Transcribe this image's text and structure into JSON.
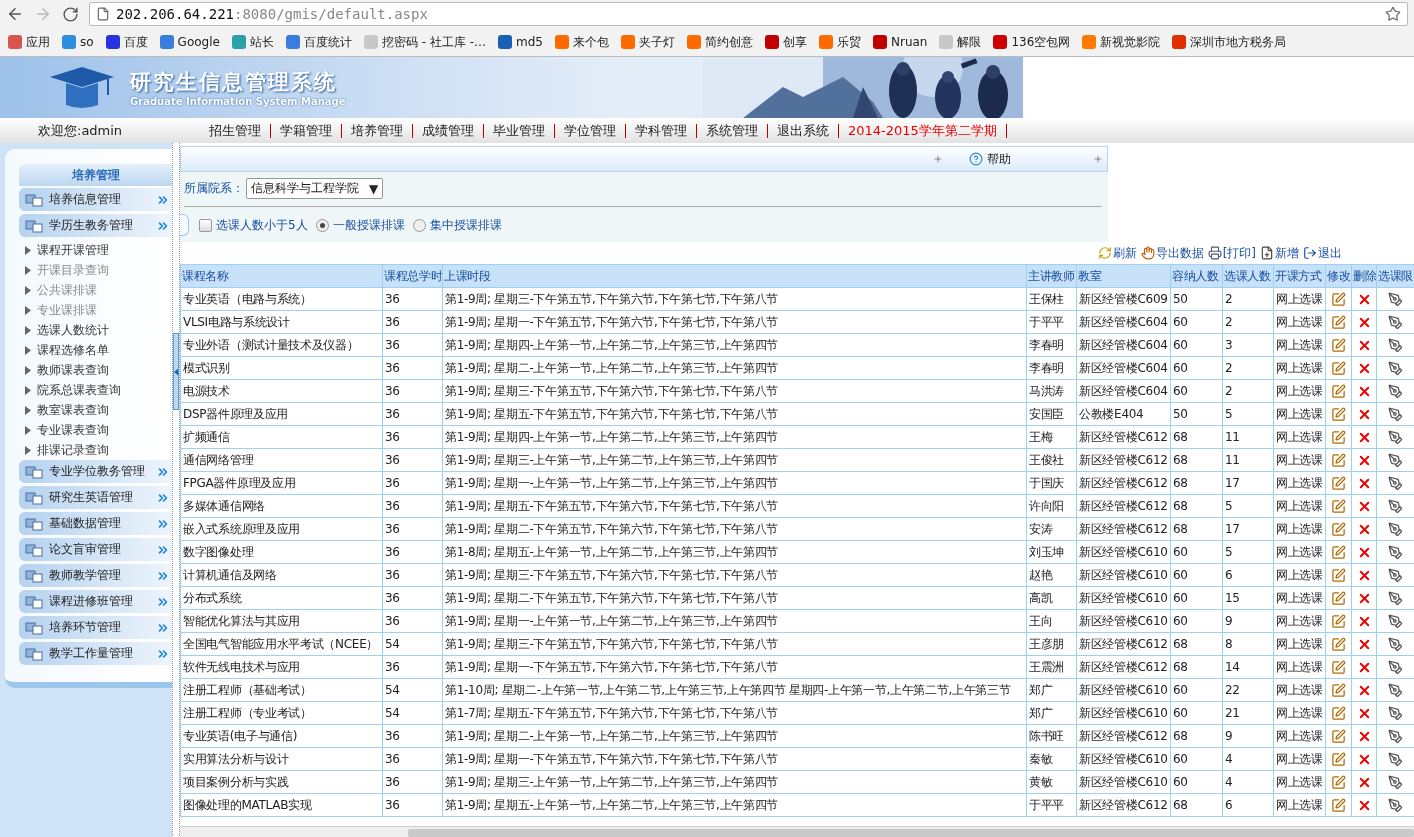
{
  "browser": {
    "address": {
      "host": "202.206.64.221",
      "rest": ":8080/gmis/default.aspx"
    },
    "bookmarks": [
      "应用",
      "so",
      "百度",
      "Google",
      "站长",
      "百度统计",
      "挖密码 - 社工库 -…",
      "md5",
      "来个包",
      "夹子灯",
      "简约创意",
      "创享",
      "乐贸",
      "Nruan",
      "解限",
      "136空包网",
      "新视觉影院",
      "深圳市地方税务局"
    ]
  },
  "banner": {
    "title": "研究生信息管理系统",
    "subtitle": "Graduate Information System Manage"
  },
  "nav": {
    "welcome": "欢迎您:admin",
    "items": [
      {
        "label": "招生管理",
        "kind": "link"
      },
      {
        "label": "学籍管理",
        "kind": "link"
      },
      {
        "label": "培养管理",
        "kind": "link"
      },
      {
        "label": "成绩管理",
        "kind": "link"
      },
      {
        "label": "毕业管理",
        "kind": "link"
      },
      {
        "label": "学位管理",
        "kind": "link"
      },
      {
        "label": "学科管理",
        "kind": "link"
      },
      {
        "label": "系统管理",
        "kind": "link"
      },
      {
        "label": "退出系统",
        "kind": "link"
      },
      {
        "label": "2014-2015学年第二学期",
        "kind": "term"
      }
    ]
  },
  "sidebar": {
    "title": "培养管理",
    "groups": [
      {
        "label": "培养信息管理"
      },
      {
        "label": "学历生教务管理",
        "children": [
          {
            "label": "课程开课管理",
            "disabled": false
          },
          {
            "label": "开课目录查询",
            "disabled": true
          },
          {
            "label": "公共课排课",
            "disabled": true
          },
          {
            "label": "专业课排课",
            "disabled": true
          },
          {
            "label": "选课人数统计",
            "disabled": false
          },
          {
            "label": "课程选修名单",
            "disabled": false
          },
          {
            "label": "教师课表查询",
            "disabled": false
          },
          {
            "label": "院系总课表查询",
            "disabled": false
          },
          {
            "label": "教室课表查询",
            "disabled": false
          },
          {
            "label": "专业课表查询",
            "disabled": false
          },
          {
            "label": "排课记录查询",
            "disabled": false
          }
        ]
      },
      {
        "label": "专业学位教务管理"
      },
      {
        "label": "研究生英语管理"
      },
      {
        "label": "基础数据管理"
      },
      {
        "label": "论文盲审管理"
      },
      {
        "label": "教师教学管理"
      },
      {
        "label": "课程进修班管理"
      },
      {
        "label": "培养环节管理"
      },
      {
        "label": "教学工作量管理"
      }
    ]
  },
  "content": {
    "help": "帮助",
    "department": {
      "label": "所属院系：",
      "value": "信息科学与工程学院",
      "arrow": "▼"
    },
    "options": [
      {
        "label": "选课人数小于5人",
        "kind": "checkbox",
        "checked": false
      },
      {
        "label": "一般授课排课",
        "kind": "radio",
        "selected": true
      },
      {
        "label": "集中授课排课",
        "kind": "radio",
        "selected": false
      }
    ],
    "actions": [
      {
        "label": "刷新",
        "kind": "refresh"
      },
      {
        "label": "导出数据",
        "kind": "export"
      },
      {
        "label": "[打印]",
        "kind": "print"
      },
      {
        "label": "新增",
        "kind": "add"
      },
      {
        "label": "退出",
        "kind": "exit"
      }
    ],
    "table": {
      "columns": [
        "课程名称",
        "课程总学时",
        "上课时段",
        "主讲教师",
        "教室",
        "容纳人数",
        "选课人数",
        "开课方式",
        "修改",
        "删除",
        "选课限"
      ],
      "rows": [
        [
          "专业英语（电路与系统）",
          "36",
          "第1-9周; 星期三-下午第五节,下午第六节,下午第七节,下午第八节",
          "王保柱",
          "新区经管楼C609",
          "50",
          "2",
          "网上选课"
        ],
        [
          "VLSI电路与系统设计",
          "36",
          "第1-9周; 星期一-下午第五节,下午第六节,下午第七节,下午第八节",
          "于平平",
          "新区经管楼C604",
          "60",
          "2",
          "网上选课"
        ],
        [
          "专业外语（测试计量技术及仪器）",
          "36",
          "第1-9周; 星期四-上午第一节,上午第二节,上午第三节,上午第四节",
          "李春明",
          "新区经管楼C604",
          "60",
          "3",
          "网上选课"
        ],
        [
          "模式识别",
          "36",
          "第1-9周; 星期二-上午第一节,上午第二节,上午第三节,上午第四节",
          "李春明",
          "新区经管楼C604",
          "60",
          "2",
          "网上选课"
        ],
        [
          "电源技术",
          "36",
          "第1-9周; 星期三-下午第五节,下午第六节,下午第七节,下午第八节",
          "马洪涛",
          "新区经管楼C604",
          "60",
          "2",
          "网上选课"
        ],
        [
          "DSP器件原理及应用",
          "36",
          "第1-9周; 星期五-下午第五节,下午第六节,下午第七节,下午第八节",
          "安国臣",
          "公教楼E404",
          "50",
          "5",
          "网上选课"
        ],
        [
          "扩频通信",
          "36",
          "第1-9周; 星期四-上午第一节,上午第二节,上午第三节,上午第四节",
          "王梅",
          "新区经管楼C612",
          "68",
          "11",
          "网上选课"
        ],
        [
          "通信网络管理",
          "36",
          "第1-9周; 星期三-上午第一节,上午第二节,上午第三节,上午第四节",
          "王俊社",
          "新区经管楼C612",
          "68",
          "11",
          "网上选课"
        ],
        [
          "FPGA器件原理及应用",
          "36",
          "第1-9周; 星期一-上午第一节,上午第二节,上午第三节,上午第四节",
          "于国庆",
          "新区经管楼C612",
          "68",
          "17",
          "网上选课"
        ],
        [
          "多媒体通信网络",
          "36",
          "第1-9周; 星期五-下午第五节,下午第六节,下午第七节,下午第八节",
          "许向阳",
          "新区经管楼C612",
          "68",
          "5",
          "网上选课"
        ],
        [
          "嵌入式系统原理及应用",
          "36",
          "第1-9周; 星期二-下午第五节,下午第六节,下午第七节,下午第八节",
          "安涛",
          "新区经管楼C612",
          "68",
          "17",
          "网上选课"
        ],
        [
          "数字图像处理",
          "36",
          "第1-8周; 星期五-上午第一节,上午第二节,上午第三节,上午第四节",
          "刘玉坤",
          "新区经管楼C610",
          "60",
          "5",
          "网上选课"
        ],
        [
          "计算机通信及网络",
          "36",
          "第1-9周; 星期三-下午第五节,下午第六节,下午第七节,下午第八节",
          "赵艳",
          "新区经管楼C610",
          "60",
          "6",
          "网上选课"
        ],
        [
          "分布式系统",
          "36",
          "第1-9周; 星期二-下午第五节,下午第六节,下午第七节,下午第八节",
          "高凯",
          "新区经管楼C610",
          "60",
          "15",
          "网上选课"
        ],
        [
          "智能优化算法与其应用",
          "36",
          "第1-9周; 星期一-上午第一节,上午第二节,上午第三节,上午第四节",
          "王向",
          "新区经管楼C610",
          "60",
          "9",
          "网上选课"
        ],
        [
          "全国电气智能应用水平考试（NCEE）",
          "54",
          "第1-9周; 星期三-下午第五节,下午第六节,下午第七节,下午第八节",
          "王彦朋",
          "新区经管楼C612",
          "68",
          "8",
          "网上选课"
        ],
        [
          "软件无线电技术与应用",
          "36",
          "第1-9周; 星期一-下午第五节,下午第六节,下午第七节,下午第八节",
          "王震洲",
          "新区经管楼C612",
          "68",
          "14",
          "网上选课"
        ],
        [
          "注册工程师（基础考试）",
          "54",
          "第1-10周; 星期二-上午第一节,上午第二节,上午第三节,上午第四节 星期四-上午第一节,上午第二节,上午第三节",
          "郑广",
          "新区经管楼C610",
          "60",
          "22",
          "网上选课"
        ],
        [
          "注册工程师（专业考试）",
          "54",
          "第1-7周; 星期五-下午第五节,下午第六节,下午第七节,下午第八节",
          "郑广",
          "新区经管楼C610",
          "60",
          "21",
          "网上选课"
        ],
        [
          "专业英语(电子与通信)",
          "36",
          "第1-9周; 星期二-上午第一节,上午第二节,上午第三节,上午第四节",
          "陈书旺",
          "新区经管楼C612",
          "68",
          "9",
          "网上选课"
        ],
        [
          "实用算法分析与设计",
          "36",
          "第1-9周; 星期一-下午第五节,下午第六节,下午第七节,下午第八节",
          "秦敏",
          "新区经管楼C610",
          "60",
          "4",
          "网上选课"
        ],
        [
          "项目案例分析与实践",
          "36",
          "第1-9周; 星期三-上午第一节,上午第二节,上午第三节,上午第四节",
          "黄敏",
          "新区经管楼C610",
          "60",
          "4",
          "网上选课"
        ],
        [
          "图像处理的MATLAB实现",
          "36",
          "第1-9周; 星期五-上午第一节,上午第二节,上午第三节,上午第四节",
          "于平平",
          "新区经管楼C612",
          "68",
          "6",
          "网上选课"
        ]
      ]
    }
  }
}
